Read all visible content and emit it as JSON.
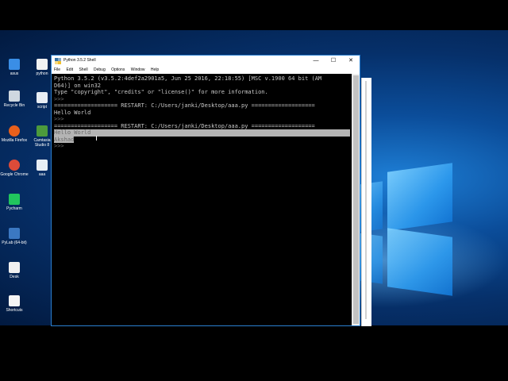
{
  "window": {
    "title": "Python 3.5.2 Shell",
    "minimize": "—",
    "maximize": "☐",
    "close": "✕"
  },
  "menu": [
    "File",
    "Edit",
    "Shell",
    "Debug",
    "Options",
    "Window",
    "Help"
  ],
  "console_lines": [
    {
      "text": "Python 3.5.2 (v3.5.2:4def2a2901a5, Jun 25 2016, 22:18:55) [MSC v.1900 64 bit (AM",
      "kind": "out"
    },
    {
      "text": "D64)] on win32",
      "kind": "out"
    },
    {
      "text": "Type \"copyright\", \"credits\" or \"license()\" for more information.",
      "kind": "out"
    },
    {
      "text": ">>> ",
      "kind": "prompt"
    },
    {
      "text": "=================== RESTART: C:/Users/janki/Desktop/aaa.py ===================",
      "kind": "restart"
    },
    {
      "text": "Hello World",
      "kind": "out"
    },
    {
      "text": ">>> ",
      "kind": "prompt"
    },
    {
      "text": "=================== RESTART: C:/Users/janki/Desktop/aaa.py ===================",
      "kind": "restart"
    },
    {
      "text": "Hello World",
      "kind": "sel-full"
    },
    {
      "text": "Akshad",
      "kind": "sel-part"
    },
    {
      "text": ">>> ",
      "kind": "prompt"
    }
  ],
  "desktop_icons": [
    {
      "label": "asus",
      "color": "#3a8ee6"
    },
    {
      "label": "python",
      "color": "#f2f2f2"
    },
    {
      "label": "Recycle Bin",
      "color": "#cfd8e0"
    },
    {
      "label": "script",
      "color": "#e8eef5"
    },
    {
      "label": "Mozilla Firefox",
      "color": "#e8601c"
    },
    {
      "label": "Camtasia Studio 8",
      "color": "#4c9a3c"
    },
    {
      "label": "Google Chrome",
      "color": "#dd4b39"
    },
    {
      "label": "aaa",
      "color": "#e8eef5"
    },
    {
      "label": "Pycharm",
      "color": "#21c55d"
    },
    {
      "label": "PyLab (64-bit)",
      "color": "#3b78c2"
    },
    {
      "label": "Desk",
      "color": "#f0f0f0"
    },
    {
      "label": "Shortcuts",
      "color": "#f5f5f5"
    }
  ]
}
